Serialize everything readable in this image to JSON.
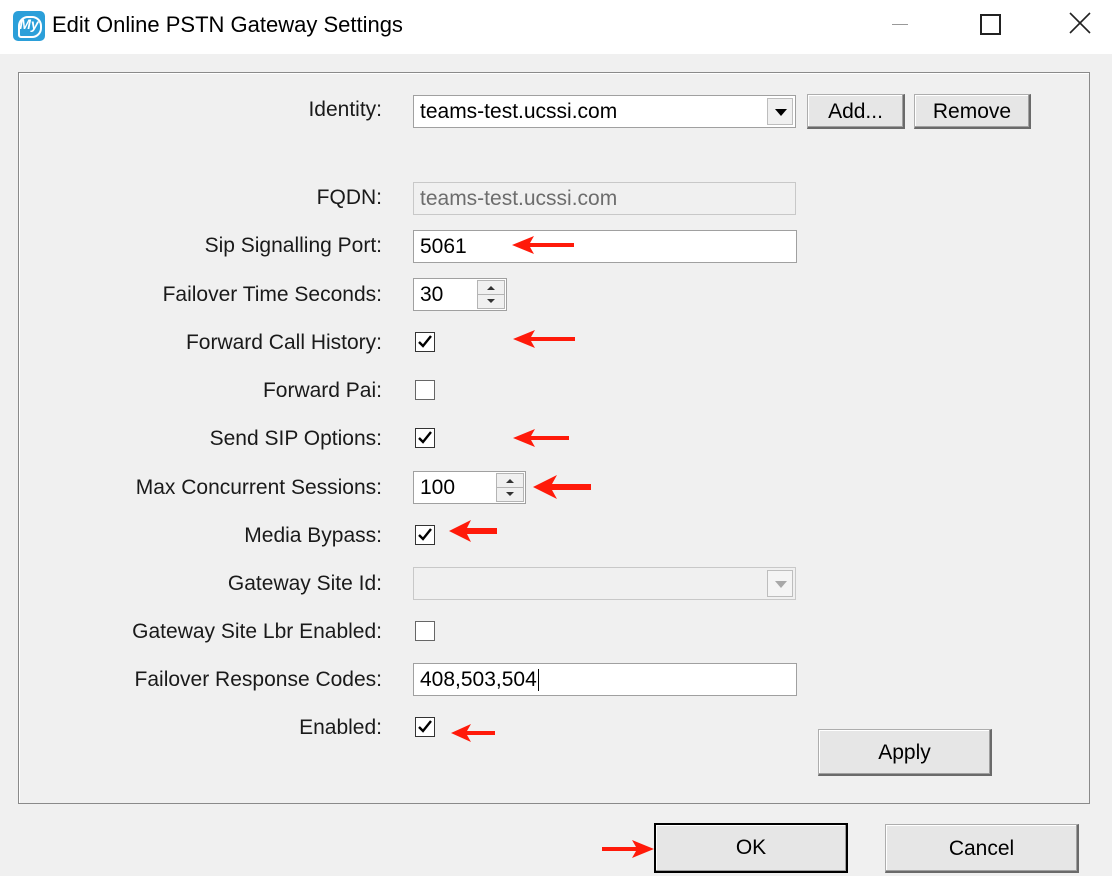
{
  "window": {
    "title": "Edit Online PSTN Gateway Settings",
    "app_icon": "My",
    "accent_color": "#2b9fd9"
  },
  "form": {
    "identity": {
      "label": "Identity:",
      "value": "teams-test.ucssi.com"
    },
    "add_label": "Add...",
    "remove_label": "Remove",
    "fqdn": {
      "label": "FQDN:",
      "value": "teams-test.ucssi.com"
    },
    "sip_port": {
      "label": "Sip Signalling Port:",
      "value": "5061"
    },
    "failover_time": {
      "label": "Failover Time Seconds:",
      "value": "30"
    },
    "forward_call_history": {
      "label": "Forward Call History:",
      "checked": true
    },
    "forward_pai": {
      "label": "Forward Pai:",
      "checked": false
    },
    "send_sip_options": {
      "label": "Send SIP Options:",
      "checked": true
    },
    "max_sessions": {
      "label": "Max Concurrent Sessions:",
      "value": "100"
    },
    "media_bypass": {
      "label": "Media Bypass:",
      "checked": true
    },
    "gateway_site_id": {
      "label": "Gateway Site Id:",
      "value": ""
    },
    "gateway_site_lbr": {
      "label": "Gateway Site Lbr Enabled:",
      "checked": false
    },
    "failover_codes": {
      "label": "Failover Response Codes:",
      "value": "408,503,504"
    },
    "enabled": {
      "label": "Enabled:",
      "checked": true
    },
    "apply_label": "Apply"
  },
  "footer": {
    "ok_label": "OK",
    "cancel_label": "Cancel"
  },
  "annotation_color": "#ff1a0a"
}
